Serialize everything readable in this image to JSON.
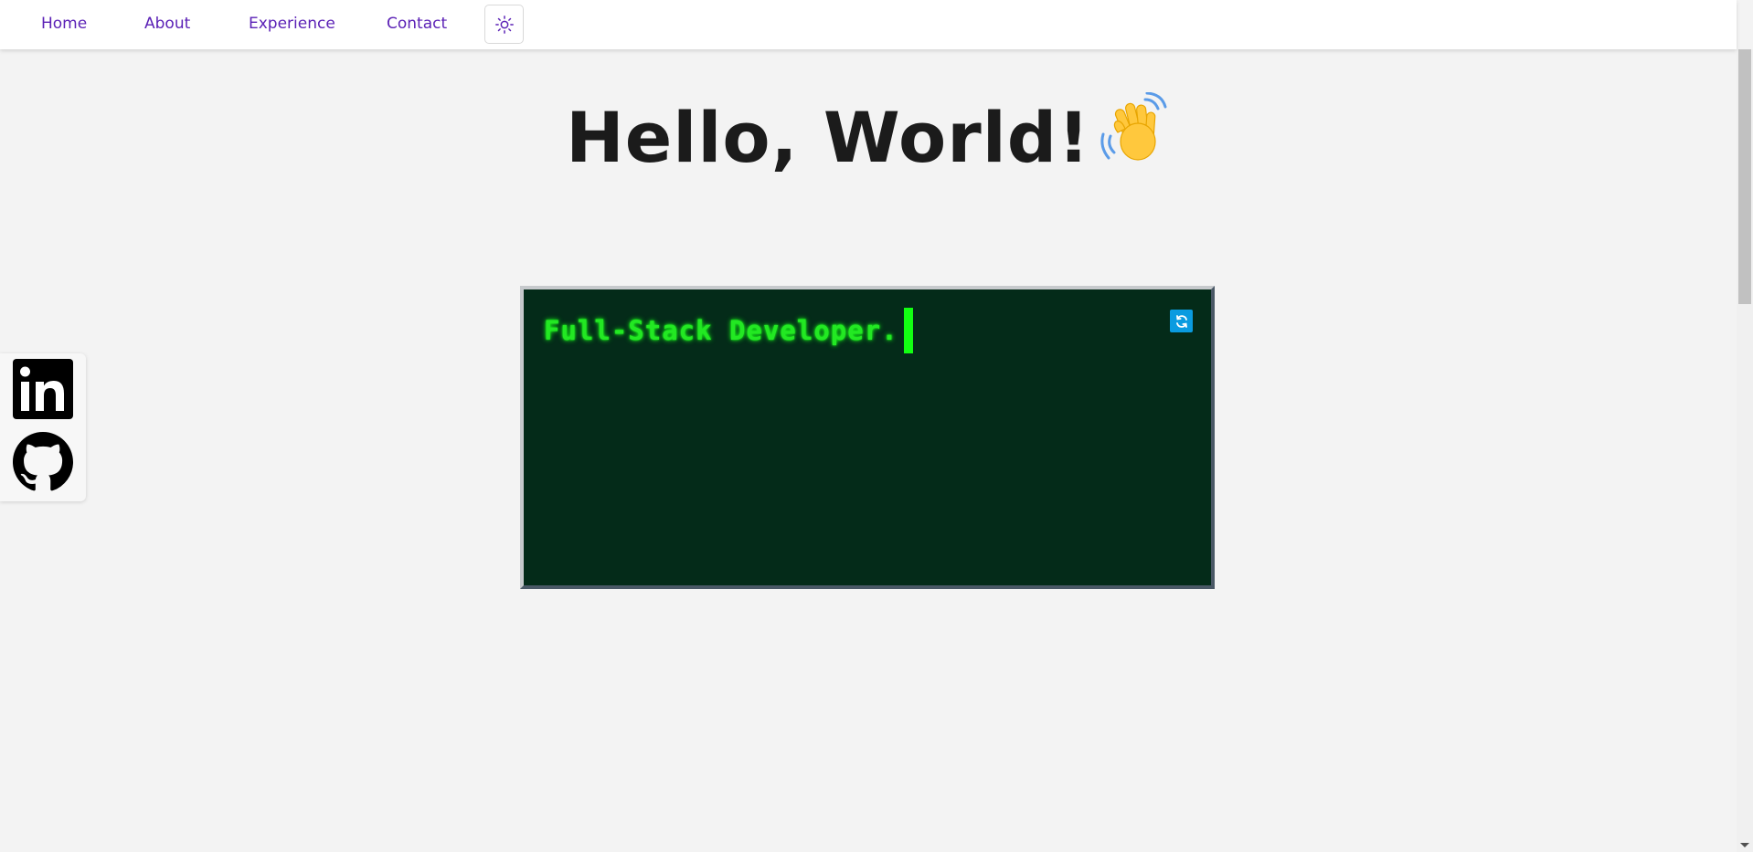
{
  "nav": {
    "links": [
      {
        "label": "Home"
      },
      {
        "label": "About"
      },
      {
        "label": "Experience"
      },
      {
        "label": "Contact"
      }
    ],
    "theme_toggle_icon": "sun-icon"
  },
  "hero": {
    "title": "Hello, World!",
    "emoji_icon": "waving-hand-icon"
  },
  "terminal": {
    "text": "Full-Stack Developer.",
    "refresh_icon": "refresh-icon",
    "colors": {
      "background": "#042b19",
      "text": "#23e823",
      "cursor": "#12ff12"
    }
  },
  "social": {
    "items": [
      {
        "icon": "linkedin-icon"
      },
      {
        "icon": "github-icon"
      }
    ]
  },
  "colors": {
    "accent": "#5b21b6",
    "page_background": "#f3f3f3",
    "refresh_button": "#0a9be0"
  }
}
